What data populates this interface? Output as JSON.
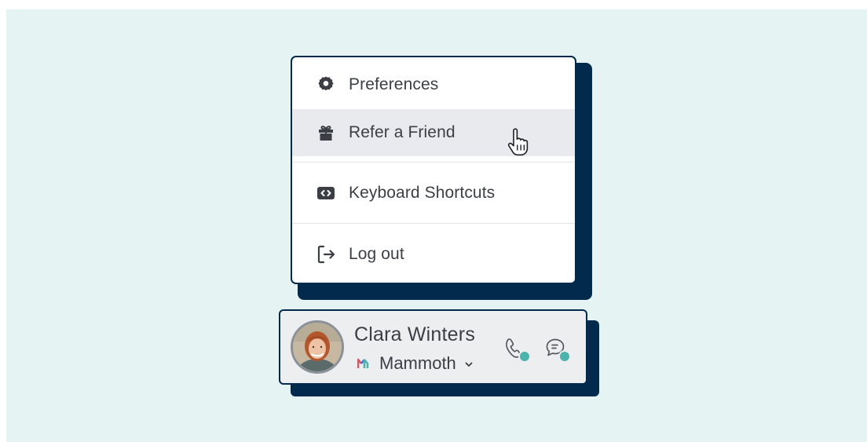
{
  "menu": {
    "items": [
      {
        "label": "Preferences",
        "icon": "gear-icon"
      },
      {
        "label": "Refer a Friend",
        "icon": "gift-icon",
        "hovered": true
      },
      {
        "label": "Keyboard Shortcuts",
        "icon": "code-icon"
      },
      {
        "label": "Log out",
        "icon": "logout-icon"
      }
    ]
  },
  "user": {
    "name": "Clara Winters",
    "workspace": "Mammoth"
  },
  "colors": {
    "background": "#e5f3f3",
    "border": "#022a4c",
    "hover": "#e8eaed",
    "status_dot": "#4ab5ad",
    "text": "#3b3f45"
  }
}
